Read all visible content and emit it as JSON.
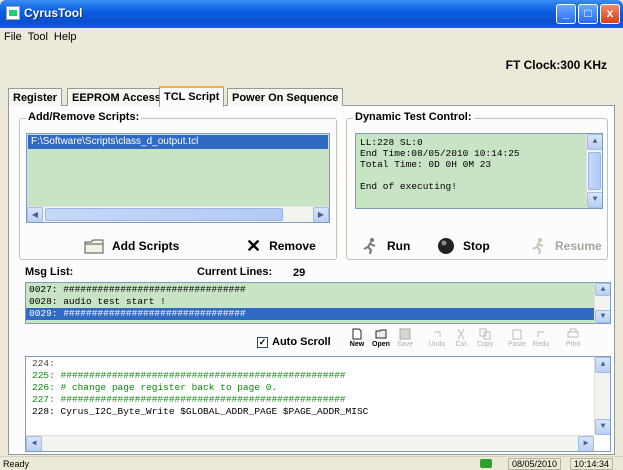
{
  "window": {
    "title": "CyrusTool",
    "minimize": "_",
    "maximize": "□",
    "close": "x"
  },
  "menu": [
    "File",
    "Tool",
    "Help"
  ],
  "ft_clock": "FT Clock:300 KHz",
  "tabs": [
    "Register",
    "EEPROM Access",
    "TCL Script",
    "Power On Sequence"
  ],
  "add_remove": {
    "title": "Add/Remove Scripts:",
    "selected_path": "F:\\Software\\Scripts\\class_d_output.tcl",
    "add_label": "Add Scripts",
    "remove_label": "Remove"
  },
  "dynamic": {
    "title": "Dynamic Test Control:",
    "lines": [
      "LL:228  SL:0",
      "End Time:08/05/2010 10:14:25",
      "Total Time: 0D 0H 0M 23",
      "",
      "End of executing!"
    ],
    "run_label": "Run",
    "stop_label": "Stop",
    "resume_label": "Resume"
  },
  "msg": {
    "label": "Msg List:",
    "current_lines_label": "Current Lines:",
    "current_lines_value": "29",
    "rows": [
      "0027: ################################",
      "0028:      audio test start !",
      "0029: ################################"
    ]
  },
  "editor": {
    "auto_scroll_label": "Auto Scroll",
    "toolbar": [
      "New",
      "Open",
      "Save",
      "Undo",
      "Cut",
      "Copy",
      "Paste",
      "Redo",
      "Print"
    ],
    "lines": [
      "  224:",
      "  225: ##################################################",
      "  226: # change page register back to page 0.",
      "  227: ##################################################",
      "  228: Cyrus_I2C_Byte_Write    $GLOBAL_ADDR_PAGE    $PAGE_ADDR_MISC"
    ]
  },
  "status": {
    "left": "Ready",
    "date": "08/05/2010",
    "time": "10:14:34"
  }
}
